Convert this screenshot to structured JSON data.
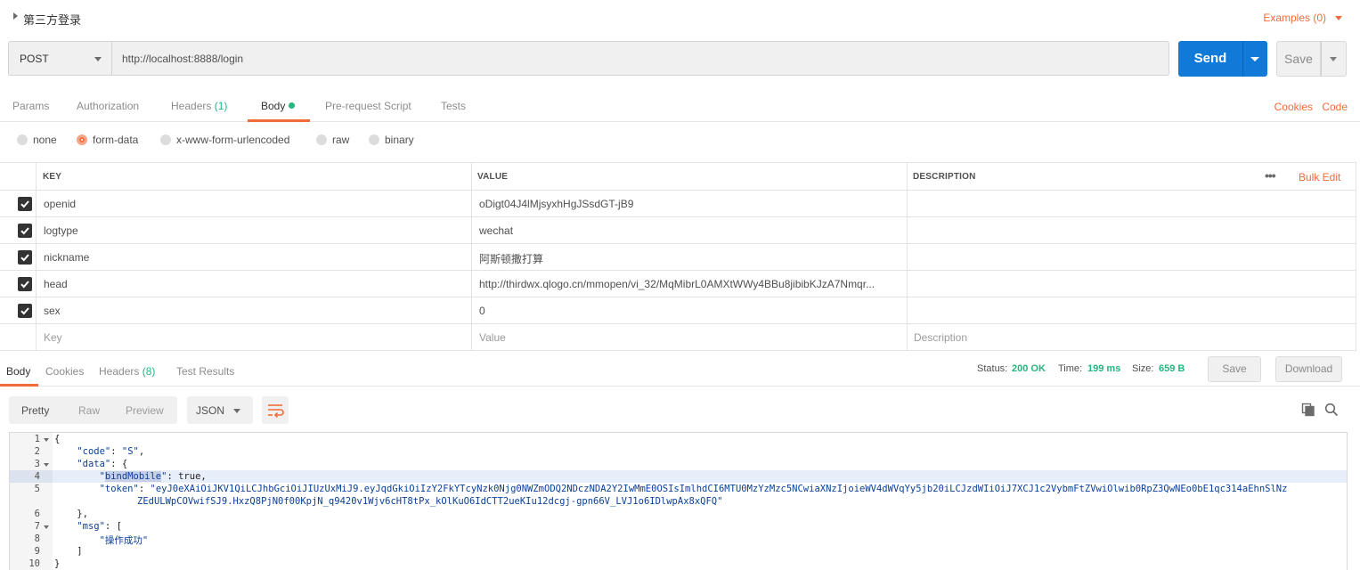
{
  "request": {
    "title": "第三方登录",
    "examples_label": "Examples (0)",
    "method": "POST",
    "url": "http://localhost:8888/login",
    "send_label": "Send",
    "save_label": "Save"
  },
  "request_tabs": {
    "params": "Params",
    "authorization": "Authorization",
    "headers": "Headers",
    "headers_count": "(1)",
    "body": "Body",
    "pre_request": "Pre-request Script",
    "tests": "Tests",
    "cookies_link": "Cookies",
    "code_link": "Code"
  },
  "body_types": {
    "none": "none",
    "form_data": "form-data",
    "urlencoded": "x-www-form-urlencoded",
    "raw": "raw",
    "binary": "binary",
    "selected": "form-data"
  },
  "table": {
    "headers": {
      "key": "KEY",
      "value": "VALUE",
      "description": "DESCRIPTION"
    },
    "more_label": "•••",
    "bulk_edit": "Bulk Edit",
    "rows": [
      {
        "key": "openid",
        "value": "oDigt04J4lMjsyxhHgJSsdGT-jB9",
        "checked": true
      },
      {
        "key": "logtype",
        "value": "wechat",
        "checked": true
      },
      {
        "key": "nickname",
        "value": "阿斯顿撒打算",
        "checked": true
      },
      {
        "key": "head",
        "value": "http://thirdwx.qlogo.cn/mmopen/vi_32/MqMibrL0AMXtWWy4BBu8jibibKJzA7Nmqr...",
        "checked": true
      },
      {
        "key": "sex",
        "value": "0",
        "checked": true
      }
    ],
    "placeholders": {
      "key": "Key",
      "value": "Value",
      "description": "Description"
    }
  },
  "response_tabs": {
    "body": "Body",
    "cookies": "Cookies",
    "headers": "Headers",
    "headers_count": "(8)",
    "test_results": "Test Results"
  },
  "response_meta": {
    "status_label": "Status:",
    "status_value": "200 OK",
    "time_label": "Time:",
    "time_value": "199 ms",
    "size_label": "Size:",
    "size_value": "659 B",
    "save_label": "Save",
    "download_label": "Download"
  },
  "response_toolbar": {
    "pretty": "Pretty",
    "raw": "Raw",
    "preview": "Preview",
    "format": "JSON"
  },
  "code": {
    "line_numbers": [
      "1",
      "2",
      "3",
      "4",
      "5",
      "",
      "6",
      "7",
      "8",
      "9",
      "10"
    ],
    "open_brace": "{",
    "code_key": "\"code\"",
    "code_val": "\"S\"",
    "data_key": "\"data\"",
    "bind_key_open": "\"",
    "bind_key": "bindMobile",
    "bind_key_close": "\"",
    "bind_val": "true",
    "token_key": "\"token\"",
    "token_val_1": "\"eyJ0eXAiOiJKV1QiLCJhbGciOiJIUzUxMiJ9.eyJqdGkiOiIzY2FkYTcyNzk0Njg0NWZmODQ2NDczNDA2Y2IwMmE0OSIsImlhdCI6MTU0MzYzMzc5NCwiaXNzIjoieWV4dWVqYy5jb20iLCJzdWIiOiJ7XCJ1c2VybmFtZVwiOlwib0RpZ3QwNEo0bE1qc314aEhnSlNz",
    "token_val_2": "ZEdULWpCOVwifSJ9.HxzQ8PjN0f00KpjN_q9420v1Wjv6cHT8tPx_kOlKuO6IdCTT2ueKIu12dcgj-gpn66V_LVJ1o6IDlwpAx8xQFQ\"",
    "data_close": "},",
    "msg_key": "\"msg\"",
    "msg_open": "[",
    "msg_val": "\"操作成功\"",
    "msg_close": "]",
    "close_brace": "}"
  }
}
